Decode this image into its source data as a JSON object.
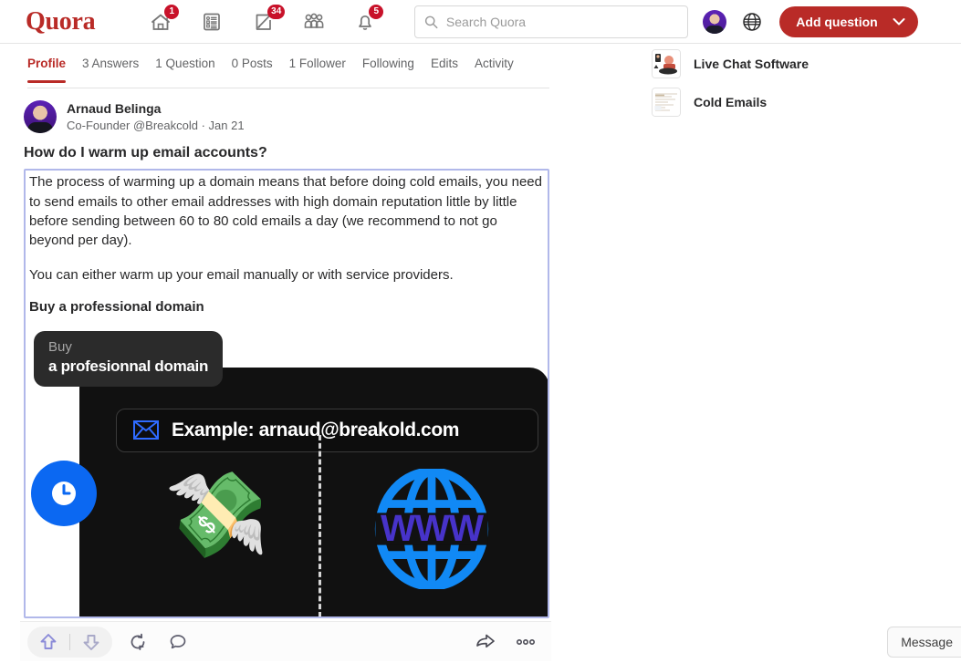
{
  "header": {
    "brand": "Quora",
    "nav": [
      {
        "name": "home",
        "badge": "1"
      },
      {
        "name": "answer",
        "badge": ""
      },
      {
        "name": "write",
        "badge": "34"
      },
      {
        "name": "spaces",
        "badge": ""
      },
      {
        "name": "notifications",
        "badge": "5"
      }
    ],
    "search": {
      "placeholder": "Search Quora",
      "value": ""
    },
    "add_question_label": "Add question"
  },
  "tabs": [
    {
      "label": "Profile",
      "active": true
    },
    {
      "label": "3 Answers",
      "active": false
    },
    {
      "label": "1 Question",
      "active": false
    },
    {
      "label": "0 Posts",
      "active": false
    },
    {
      "label": "1 Follower",
      "active": false
    },
    {
      "label": "Following",
      "active": false
    },
    {
      "label": "Edits",
      "active": false
    },
    {
      "label": "Activity",
      "active": false
    }
  ],
  "answer": {
    "author_name": "Arnaud Belinga",
    "author_meta": "Co-Founder @Breakcold · Jan 21",
    "question_title": "How do I warm up email accounts?",
    "paragraph_1": "The process of warming up a domain means that before doing cold emails, you need to send emails to other email addresses with high domain reputation little by little before sending between 60 to 80 cold emails a day (we recommend to not go beyond per day).",
    "paragraph_2": "You can either warm up your email manually or with service providers.",
    "subheading": "Buy a professional domain",
    "graphic": {
      "label_line1": "Buy",
      "label_line2": "a profesionnal domain",
      "example_text": "Example: arnaud@breakold.com"
    }
  },
  "actionbar": {
    "upvote": "upvote-arrow-icon",
    "downvote": "downvote-arrow-icon",
    "repost": "repost-icon",
    "comment": "comment-bubble-icon",
    "share": "share-arrow-icon",
    "more": "more-options-icon"
  },
  "sidebar": {
    "ads": [
      {
        "label": "Live Chat Software"
      },
      {
        "label": "Cold Emails"
      }
    ]
  },
  "message_button_label": "Message",
  "colors": {
    "brand_red": "#b92b27",
    "badge_red": "#c8122a",
    "selection_border": "#b1b8ea",
    "graphic_bg": "#111111",
    "clock_blue": "#0b68f2",
    "www_blue": "#1189f5",
    "www_letters": "#4733c9"
  }
}
